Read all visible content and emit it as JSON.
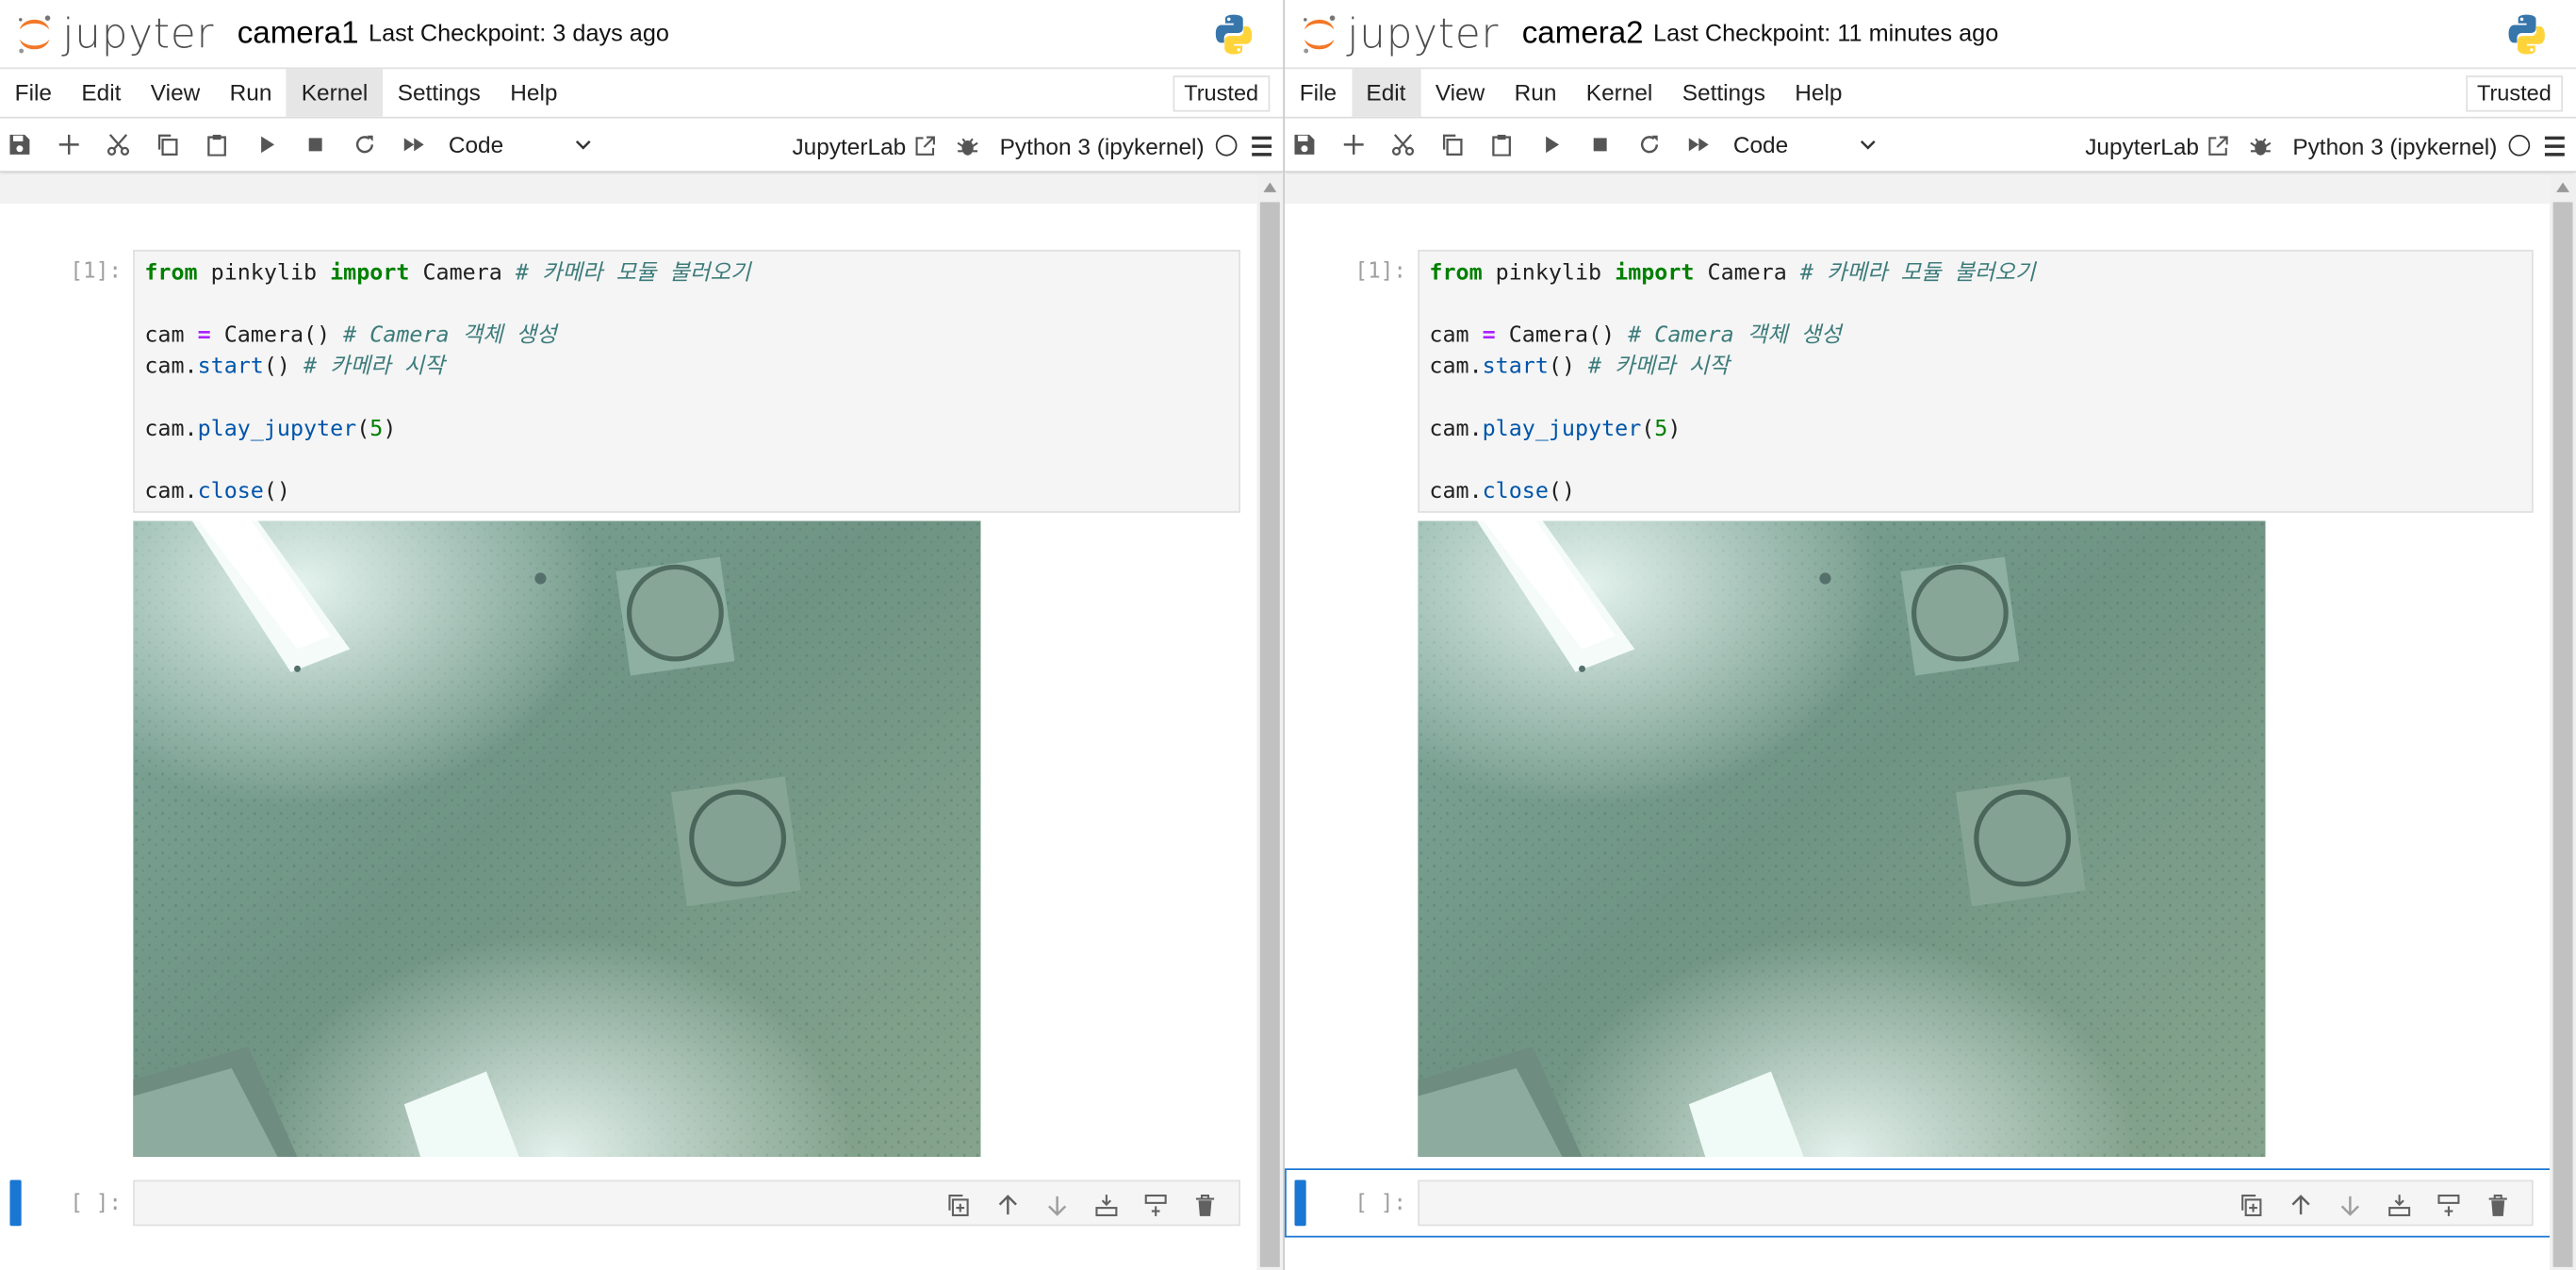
{
  "app": {
    "logo_text": "jupyter"
  },
  "windows": [
    {
      "notebook_name": "camera1",
      "checkpoint": "Last Checkpoint: 3 days ago",
      "menu": [
        "File",
        "Edit",
        "View",
        "Run",
        "Kernel",
        "Settings",
        "Help"
      ],
      "active_menu": "Kernel",
      "trusted": "Trusted",
      "cell_type": "Code",
      "jupyterlab_link": "JupyterLab",
      "kernel": "Python 3 (ipykernel)",
      "cells": [
        {
          "prompt": "[1]:"
        },
        {
          "prompt": "[ ]:"
        }
      ]
    },
    {
      "notebook_name": "camera2",
      "checkpoint": "Last Checkpoint: 11 minutes ago",
      "menu": [
        "File",
        "Edit",
        "View",
        "Run",
        "Kernel",
        "Settings",
        "Help"
      ],
      "active_menu": "Edit",
      "trusted": "Trusted",
      "cell_type": "Code",
      "jupyterlab_link": "JupyterLab",
      "kernel": "Python 3 (ipykernel)",
      "cells": [
        {
          "prompt": "[1]:"
        },
        {
          "prompt": "[ ]:"
        }
      ]
    }
  ],
  "code": {
    "l1_from": "from",
    "l1_mod": " pinkylib ",
    "l1_import": "import",
    "l1_cls": " Camera ",
    "l1_comment": "# 카메라 모듈 불러오기",
    "l3_a": "cam ",
    "l3_op": "=",
    "l3_b": " Camera() ",
    "l3_comment": "# Camera 객체 생성",
    "l4_a": "cam.",
    "l4_fn": "start",
    "l4_b": "() ",
    "l4_comment": "# 카메라 시작",
    "l6_a": "cam.",
    "l6_fn": "play_jupyter",
    "l6_b": "(",
    "l6_num": "5",
    "l6_c": ")",
    "l8_a": "cam.",
    "l8_fn": "close",
    "l8_b": "()"
  },
  "colors": {
    "accent": "#1976d2",
    "jupyter_orange": "#f37726"
  },
  "icons": [
    "save-icon",
    "add-icon",
    "cut-icon",
    "copy-icon",
    "paste-icon",
    "run-icon",
    "stop-icon",
    "restart-icon",
    "fast-forward-icon",
    "chevron-down-icon",
    "external-link-icon",
    "bug-icon",
    "kernel-status-icon",
    "menu-icon",
    "python-logo-icon",
    "duplicate-icon",
    "move-up-icon",
    "move-down-icon",
    "insert-below-icon",
    "insert-above-icon",
    "delete-icon"
  ]
}
